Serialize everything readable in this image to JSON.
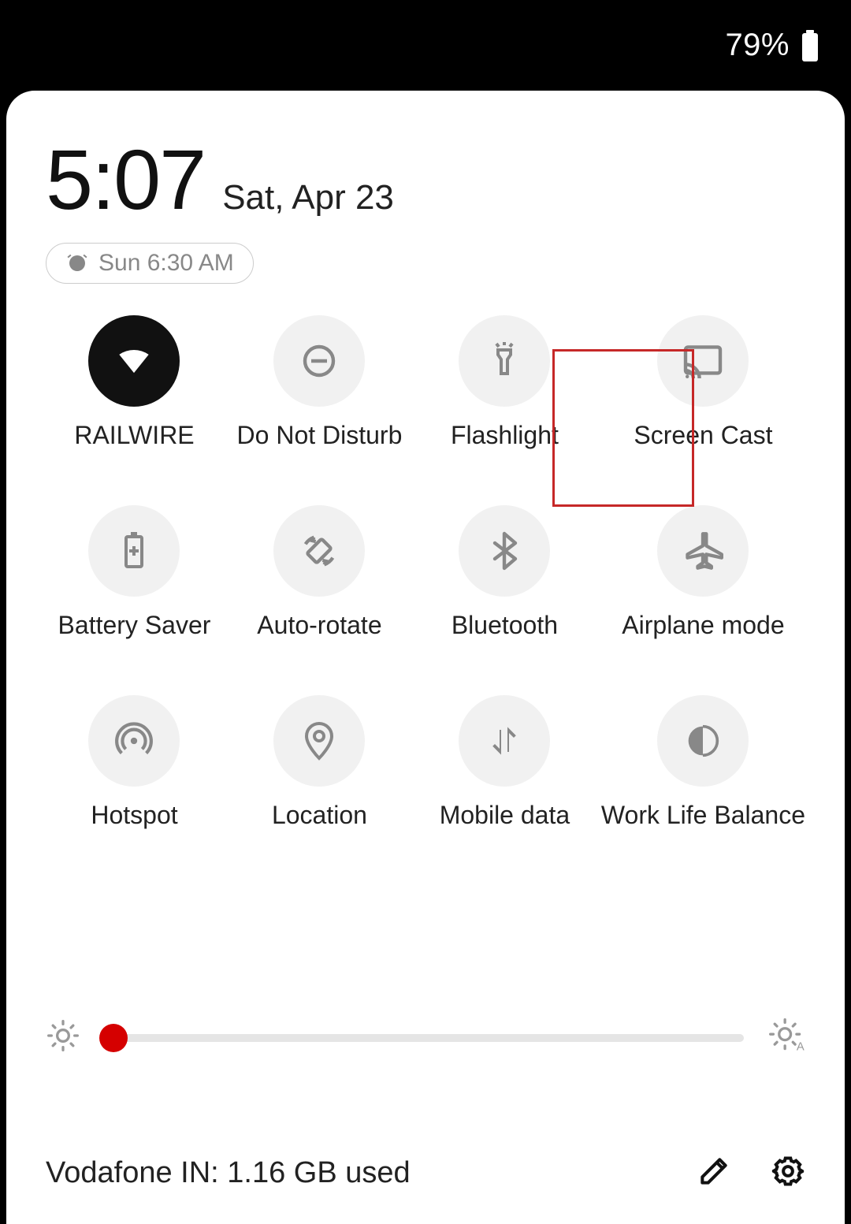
{
  "status": {
    "battery_pct": "79%"
  },
  "clock": {
    "time": "5:07",
    "date": "Sat, Apr 23"
  },
  "alarm": {
    "label": "Sun 6:30 AM"
  },
  "tiles": [
    {
      "id": "wifi",
      "label": "RAILWIRE",
      "active": true
    },
    {
      "id": "dnd",
      "label": "Do Not Disturb",
      "active": false
    },
    {
      "id": "flashlight",
      "label": "Flashlight",
      "active": false
    },
    {
      "id": "screencast",
      "label": "Screen Cast",
      "active": false
    },
    {
      "id": "batterysaver",
      "label": "Battery Saver",
      "active": false
    },
    {
      "id": "autorotate",
      "label": "Auto-rotate",
      "active": false
    },
    {
      "id": "bluetooth",
      "label": "Bluetooth",
      "active": false
    },
    {
      "id": "airplane",
      "label": "Airplane mode",
      "active": false
    },
    {
      "id": "hotspot",
      "label": "Hotspot",
      "active": false
    },
    {
      "id": "location",
      "label": "Location",
      "active": false
    },
    {
      "id": "mobiledata",
      "label": "Mobile data",
      "active": false
    },
    {
      "id": "worklife",
      "label": "Work Life Balance",
      "active": false
    }
  ],
  "brightness": {
    "value_pct": 5
  },
  "footer": {
    "data_usage": "Vodafone IN: 1.16 GB used"
  },
  "colors": {
    "accent": "#d50000",
    "highlight": "#c62828"
  }
}
